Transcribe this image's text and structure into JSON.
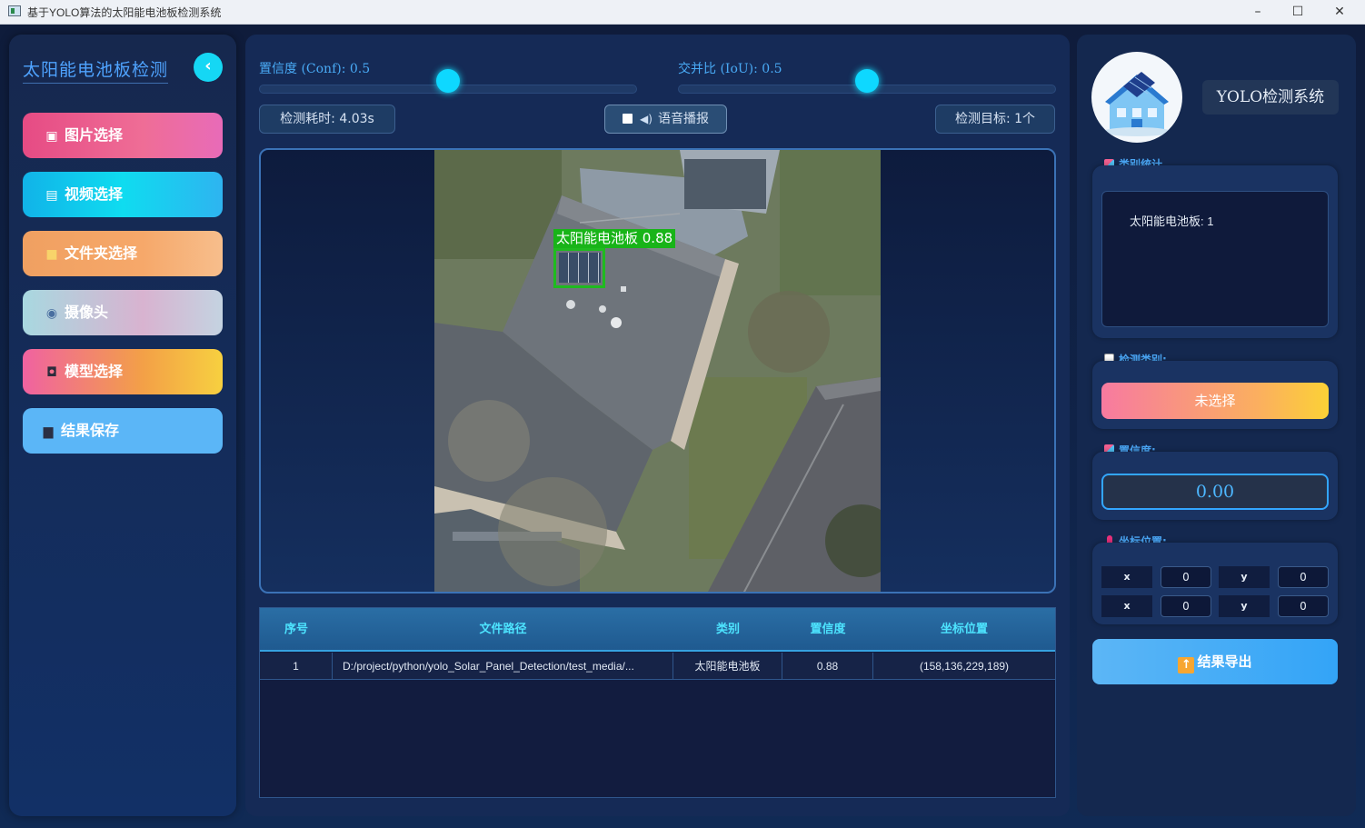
{
  "window": {
    "title": "基于YOLO算法的太阳能电池板检测系统",
    "minimize": "–",
    "maximize": "☐",
    "close": "✕"
  },
  "sidebar": {
    "brand": "太阳能电池板检测",
    "collapse_icon": "chevron-left",
    "items": [
      {
        "label": "图片选择",
        "icon": "image-icon"
      },
      {
        "label": "视频选择",
        "icon": "clapperboard-icon"
      },
      {
        "label": "文件夹选择",
        "icon": "folder-icon"
      },
      {
        "label": "摄像头",
        "icon": "webcam-icon"
      },
      {
        "label": "模型选择",
        "icon": "robot-icon"
      },
      {
        "label": "结果保存",
        "icon": "floppy-icon"
      }
    ]
  },
  "controls": {
    "conf_label": "置信度 (Conf): 0.5",
    "conf_value": 0.5,
    "iou_label": "交并比 (IoU): 0.5",
    "iou_value": 0.5,
    "time_label": "检测耗时: 4.03s",
    "voice_label": "语音播报",
    "targets_label": "检测目标: 1个"
  },
  "detection": {
    "label": "太阳能电池板 0.88",
    "class": "太阳能电池板",
    "confidence": 0.88
  },
  "table": {
    "columns": [
      "序号",
      "文件路径",
      "类别",
      "置信度",
      "坐标位置"
    ],
    "rows": [
      {
        "index": "1",
        "path": "D:/project/python/yolo_Solar_Panel_Detection/test_media/...",
        "class": "太阳能电池板",
        "conf": "0.88",
        "coords": "(158,136,229,189)"
      }
    ]
  },
  "right": {
    "system_title": "YOLO检测系统",
    "class_stats_title": "类别统计",
    "class_stats_text": "太阳能电池板: 1",
    "detect_class_title": "检测类别:",
    "detect_class_value": "未选择",
    "confidence_title": "置信度:",
    "confidence_value": "0.00",
    "coords_title": "坐标位置:",
    "coords": [
      {
        "label": "x",
        "value": "0"
      },
      {
        "label": "y",
        "value": "0"
      },
      {
        "label": "x",
        "value": "0"
      },
      {
        "label": "y",
        "value": "0"
      }
    ],
    "export_label": "结果导出"
  },
  "colors": {
    "accent": "#49aaf5",
    "cyan": "#0ed8ff",
    "detect_green": "#18b418"
  }
}
